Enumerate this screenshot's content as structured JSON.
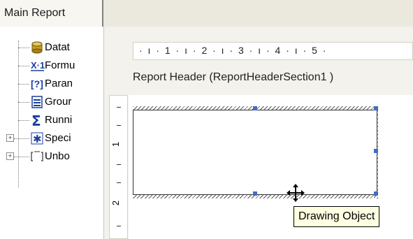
{
  "tab": {
    "label": "Main Report"
  },
  "tree": {
    "items": [
      {
        "label": "Datat",
        "icon": "database-icon",
        "expandable": false
      },
      {
        "label": "Formu",
        "icon": "formula-icon",
        "expandable": false
      },
      {
        "label": "Paran",
        "icon": "parameter-icon",
        "expandable": false
      },
      {
        "label": "Grour",
        "icon": "group-icon",
        "expandable": false
      },
      {
        "label": "Runni",
        "icon": "running-total-icon",
        "expandable": false
      },
      {
        "label": "Speci",
        "icon": "special-field-icon",
        "expandable": true,
        "expander_symbol": "+"
      },
      {
        "label": "Unbo",
        "icon": "unbound-field-icon",
        "expandable": true,
        "expander_symbol": "+"
      }
    ]
  },
  "ruler": {
    "horizontal_text": "· ı · 1 · ı · 2 · ı · 3 · ı · 4 · ı · 5 ·"
  },
  "section": {
    "title": "Report Header  (ReportHeaderSection1 )"
  },
  "vruler": {
    "marks": [
      "-",
      "-",
      "1",
      "-",
      "2",
      "-"
    ]
  },
  "tooltip": {
    "text": "Drawing Object"
  },
  "colors": {
    "handle": "#3c6fbf",
    "tooltip_bg": "#ffffe1",
    "panel_bg": "#ebe9de"
  }
}
